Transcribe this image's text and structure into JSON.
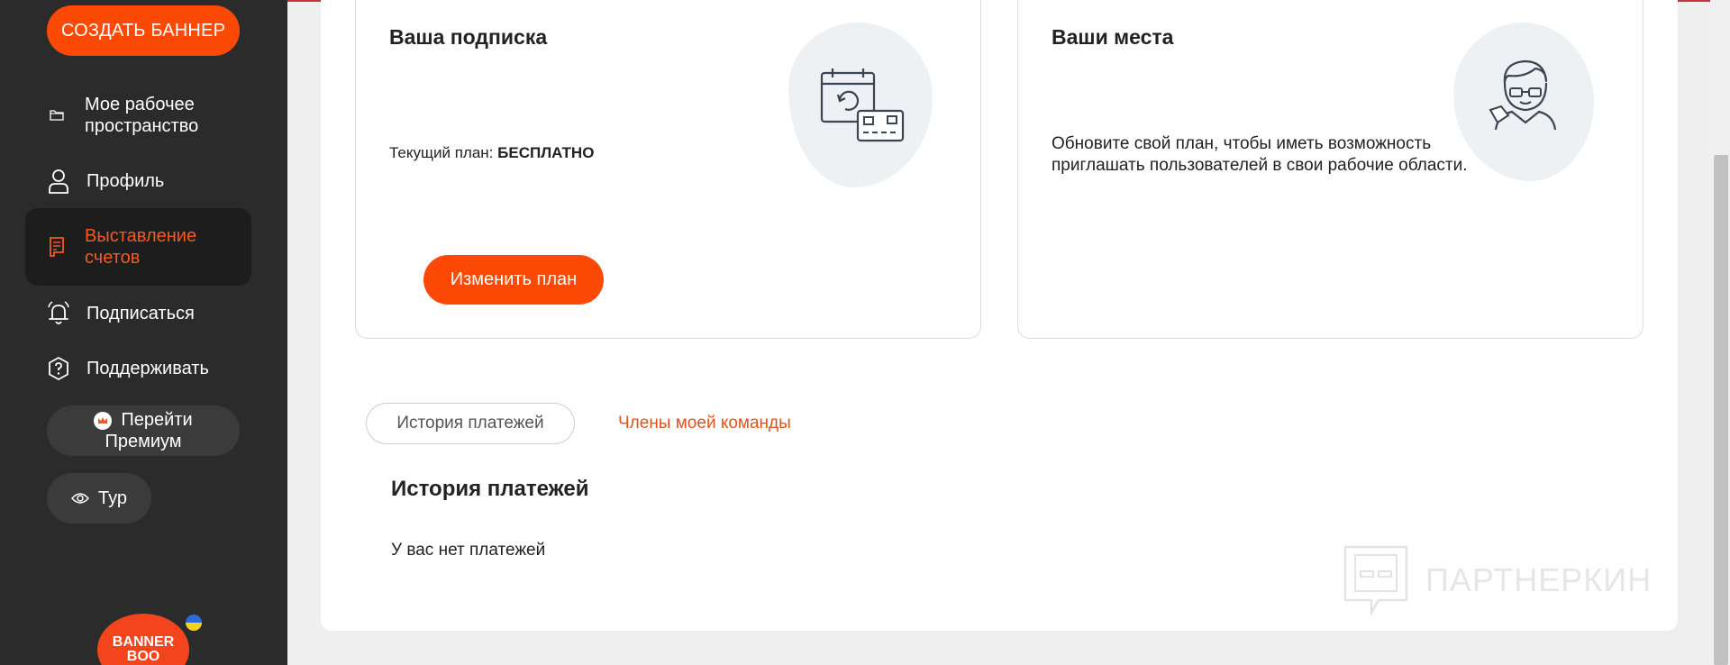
{
  "sidebar": {
    "create_button": "СОЗДАТЬ БАННЕР",
    "items": [
      {
        "label": "Мое рабочее пространство",
        "icon": "folder-icon"
      },
      {
        "label": "Профиль",
        "icon": "user-icon"
      },
      {
        "label": "Выставление счетов",
        "icon": "receipt-icon",
        "active": true
      },
      {
        "label": "Подписаться",
        "icon": "bell-icon"
      },
      {
        "label": "Поддерживать",
        "icon": "question-icon"
      }
    ],
    "premium_button": "Перейти Премиум",
    "tour_button": "Тур",
    "logo_text": "BANNER BOO"
  },
  "subscription": {
    "title": "Ваша подписка",
    "plan_label": "Текущий план:",
    "plan_value": "БЕСПЛАТНО",
    "change_button": "Изменить план"
  },
  "seats": {
    "title": "Ваши места",
    "text": "Обновите свой план, чтобы иметь возможность приглашать пользователей в свои рабочие области."
  },
  "tabs": {
    "payments": "История платежей",
    "team": "Члены моей команды"
  },
  "payments": {
    "title": "История платежей",
    "empty": "У вас нет платежей"
  },
  "watermark": "ПАРТНЕРКИН",
  "colors": {
    "accent": "#fc4a06",
    "sidebar_bg": "#2b2b2b",
    "active_text": "#f25a22"
  }
}
